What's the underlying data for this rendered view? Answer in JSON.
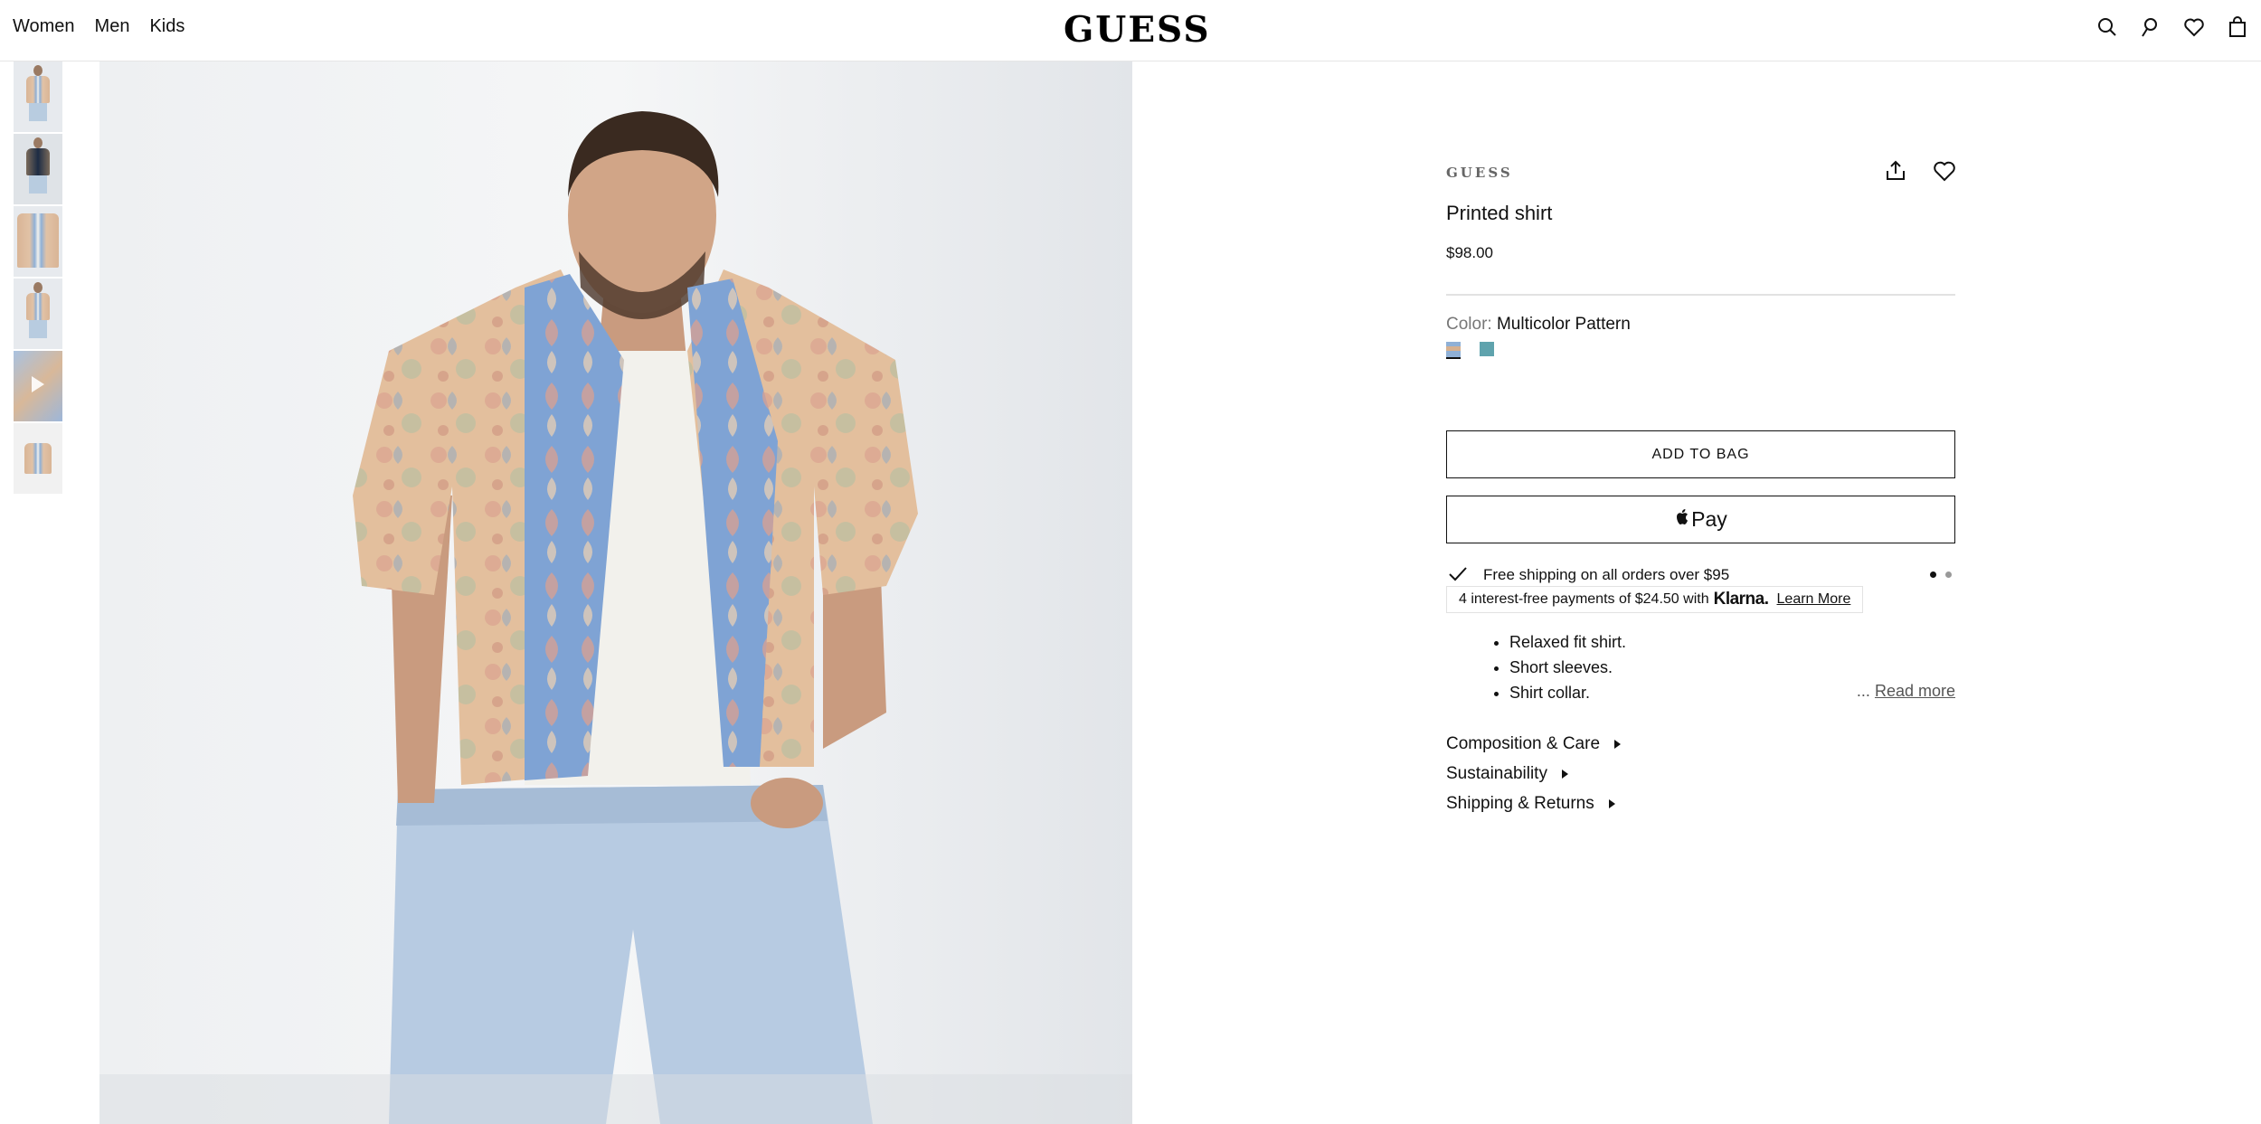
{
  "header": {
    "nav": [
      "Women",
      "Men",
      "Kids"
    ],
    "logo": "GUESS",
    "icons": [
      "search-icon",
      "account-icon",
      "wishlist-icon",
      "bag-icon"
    ]
  },
  "gallery": {
    "thumbnails": [
      "thumb-front",
      "thumb-styled",
      "thumb-detail",
      "thumb-back",
      "thumb-video",
      "thumb-flat"
    ],
    "main_image_alt": "Model wearing printed shirt"
  },
  "product": {
    "brand": "GUESS",
    "title": "Printed shirt",
    "price": "$98.00",
    "color_label": "Color:",
    "color_value": "Multicolor Pattern",
    "swatches": [
      {
        "name": "Multicolor Pattern",
        "color": "#8fb0d6",
        "selected": true
      },
      {
        "name": "Teal",
        "color": "#5fa3ad",
        "selected": false
      }
    ],
    "add_to_bag": "ADD TO BAG",
    "apple_pay": "Pay",
    "shipping_text": "Free shipping on all orders over $95",
    "klarna": {
      "prefix": "4 interest-free payments of $24.50 with",
      "logo": "Klarna.",
      "link": "Learn More"
    },
    "features": [
      "Relaxed fit shirt.",
      "Short sleeves.",
      "Shirt collar."
    ],
    "read_more_prefix": "...",
    "read_more": "Read more",
    "accordions": [
      "Composition & Care",
      "Sustainability",
      "Shipping & Returns"
    ]
  }
}
